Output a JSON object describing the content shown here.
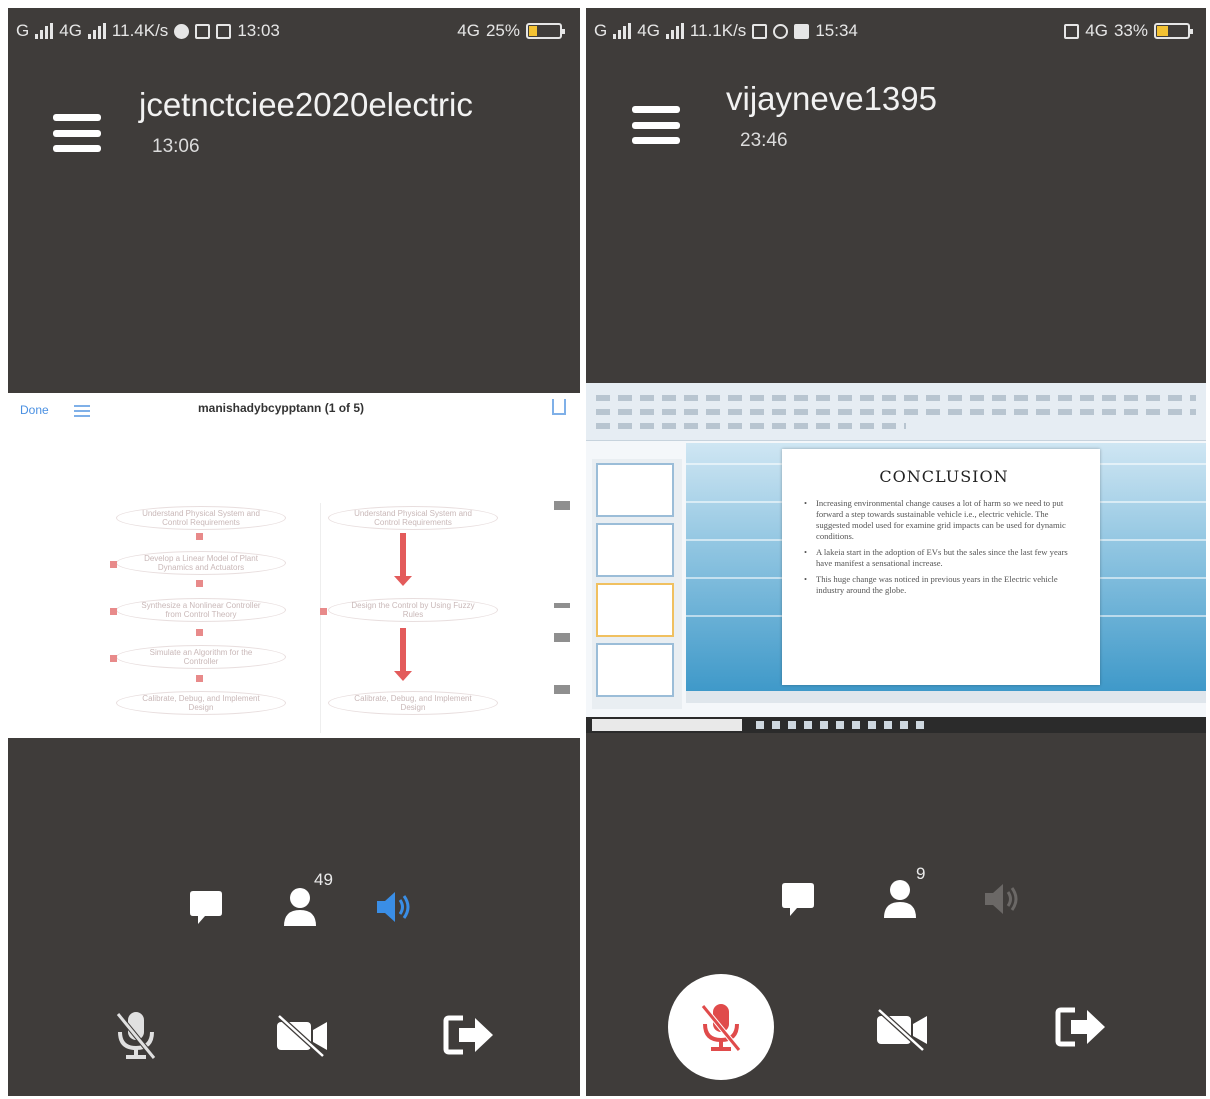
{
  "left": {
    "status": {
      "network": "G",
      "net2": "4G",
      "speed": "11.4K/s",
      "time": "13:03",
      "net_right": "4G",
      "battery": "25%"
    },
    "room_title": "jcetnctciee2020electric",
    "room_time": "13:06",
    "shared_doc": {
      "done_label": "Done",
      "title": "manishadybcypptann (1 of 5)",
      "flow_left": [
        "Understand Physical System and Control Requirements",
        "Develop a Linear Model of Plant Dynamics and Actuators",
        "Synthesize a Nonlinear Controller from Control Theory",
        "Simulate an Algorithm for the Controller",
        "Calibrate, Debug, and Implement Design"
      ],
      "flow_right": [
        "Understand Physical System and Control Requirements",
        "Design the Control by Using Fuzzy Rules",
        "Calibrate, Debug, and Implement Design"
      ]
    },
    "controls": {
      "participants_count": "49",
      "speaker_color": "#3a8ee6"
    }
  },
  "right": {
    "status": {
      "network": "G",
      "net2": "4G",
      "speed": "11.1K/s",
      "time": "15:34",
      "net_right": "4G",
      "battery": "33%"
    },
    "room_title": "vijayneve1395",
    "room_time": "23:46",
    "slide": {
      "heading": "CONCLUSION",
      "bullets": [
        "Increasing environmental change causes a lot of harm so we need to put forward a step towards sustainable vehicle i.e., electric vehicle. The suggested model used for examine grid impacts can be used for dynamic conditions.",
        "A lakeia start in the adoption of EVs but the sales since the last few years have manifest a sensational increase.",
        "This huge change was noticed in previous years in the Electric vehicle industry around the globe."
      ]
    },
    "controls": {
      "participants_count": "9",
      "mic_color": "#e04b4b"
    }
  }
}
